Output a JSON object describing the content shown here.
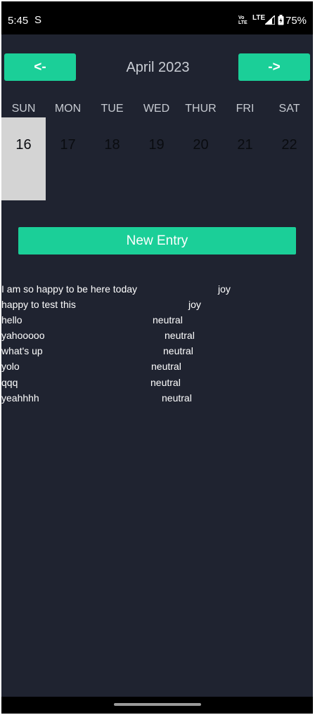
{
  "status_bar": {
    "time": "5:45",
    "sync_icon": "S",
    "volte_line1": "Vo",
    "volte_line2": "LTE",
    "lte": "LTE",
    "battery": "75%"
  },
  "calendar": {
    "prev_label": "<-",
    "next_label": "->",
    "month_title": "April 2023",
    "weekdays": [
      "SUN",
      "MON",
      "TUE",
      "WED",
      "THUR",
      "FRI",
      "SAT"
    ],
    "days": [
      "16",
      "17",
      "18",
      "19",
      "20",
      "21",
      "22"
    ],
    "selected_day": "16"
  },
  "new_entry_label": "New Entry",
  "entries": [
    {
      "text": "I am so happy to be here today",
      "mood": "joy"
    },
    {
      "text": "happy to test this",
      "mood": "joy"
    },
    {
      "text": "hello",
      "mood": "neutral"
    },
    {
      "text": "yahooooo",
      "mood": "neutral"
    },
    {
      "text": "what's up",
      "mood": "neutral"
    },
    {
      "text": "yolo",
      "mood": "neutral"
    },
    {
      "text": "qqq",
      "mood": "neutral"
    },
    {
      "text": "yeahhhh",
      "mood": "neutral"
    }
  ],
  "colors": {
    "background": "#1f2330",
    "accent": "#1bcf98",
    "selected_day": "#d4d4d4"
  }
}
